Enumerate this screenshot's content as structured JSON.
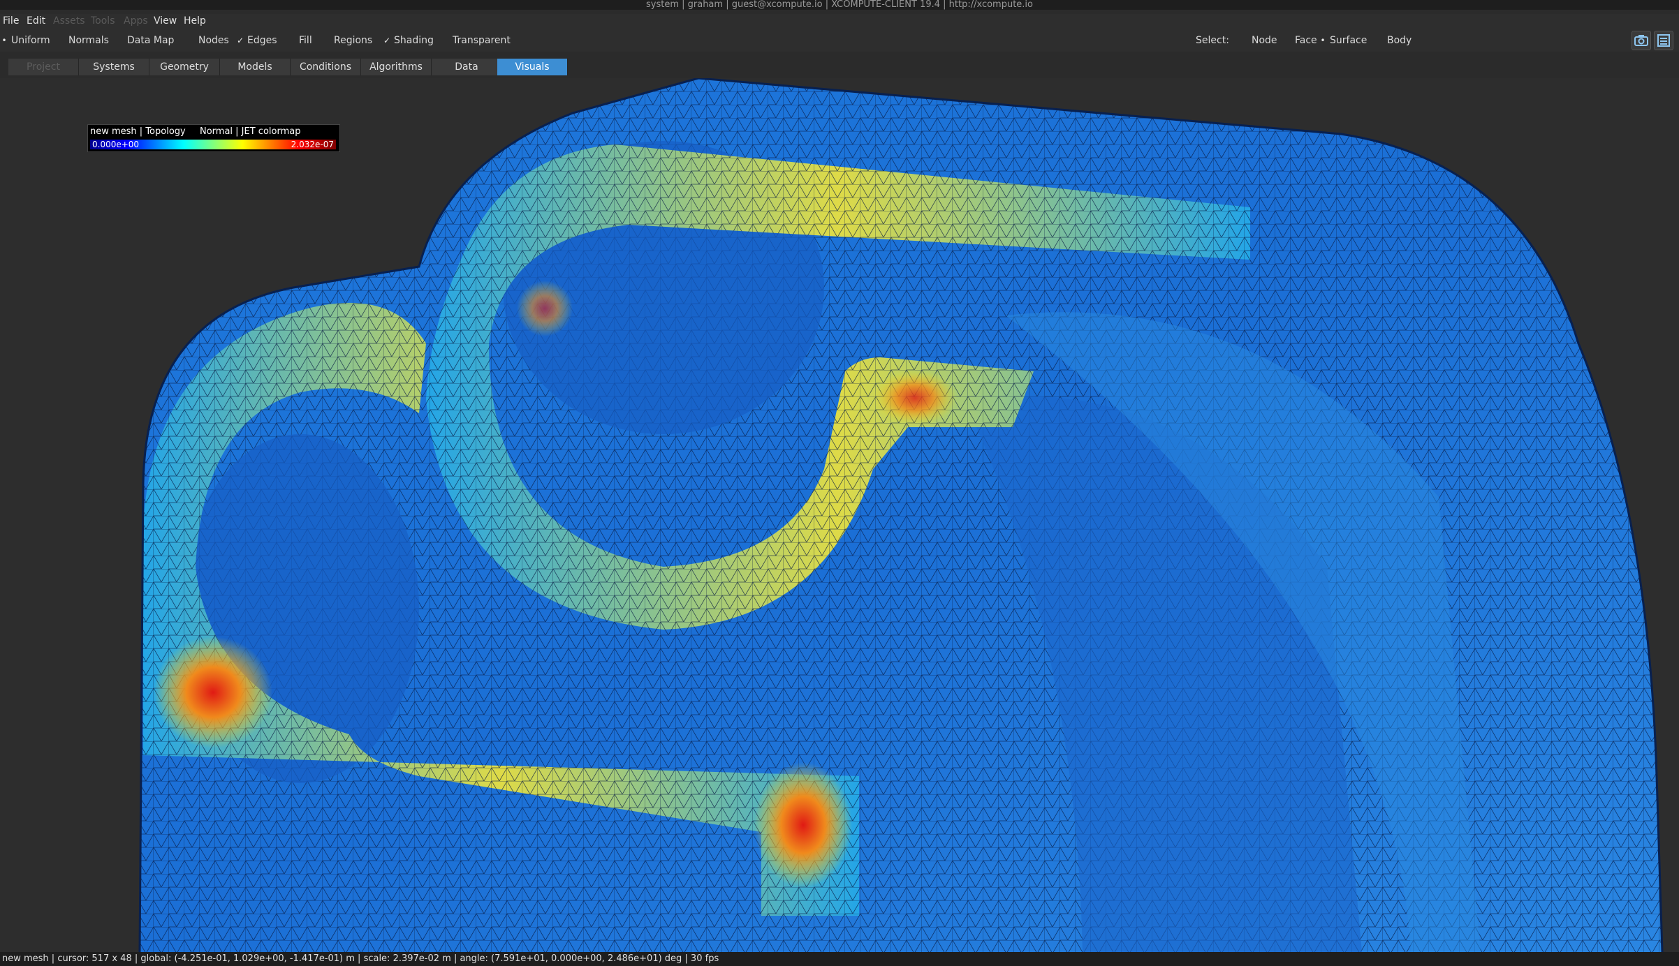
{
  "window": {
    "title": "system | graham | guest@xcompute.io | XCOMPUTE-CLIENT 19.4 | http://xcompute.io"
  },
  "menu": {
    "file": "File",
    "edit": "Edit",
    "assets": "Assets",
    "tools": "Tools",
    "apps": "Apps",
    "view": "View",
    "help": "Help"
  },
  "display_options": {
    "uniform": "Uniform",
    "normals": "Normals",
    "data_map": "Data Map",
    "nodes": "Nodes",
    "edges": "Edges",
    "fill": "Fill",
    "regions": "Regions",
    "shading": "Shading",
    "transparent": "Transparent",
    "radio_mark": "•",
    "check_mark": "✓"
  },
  "select": {
    "label": "Select:",
    "node": "Node",
    "face": "Face",
    "surface": "Surface",
    "body": "Body"
  },
  "tabs": {
    "project": "Project",
    "systems": "Systems",
    "geometry": "Geometry",
    "models": "Models",
    "conditions": "Conditions",
    "algorithms": "Algorithms",
    "data": "Data",
    "visuals": "Visuals"
  },
  "legend": {
    "title": "new mesh | Topology",
    "mode": "Normal | JET colormap",
    "min": "0.000e+00",
    "max": "2.032e-07"
  },
  "status": {
    "text": "new mesh | cursor: 517 x 48 | global: (-4.251e-01, 1.029e+00, -1.417e-01) m | scale: 2.397e-02 m | angle: (7.591e+01, 0.000e+00, 2.486e+01) deg | 30 fps"
  },
  "colors": {
    "active_tab": "#3d8ed3",
    "mesh_base": "#1c72d8",
    "mesh_hot": "#e8281c",
    "mesh_warm": "#f5e51c",
    "viewport_bg": "#2d2d2d"
  }
}
